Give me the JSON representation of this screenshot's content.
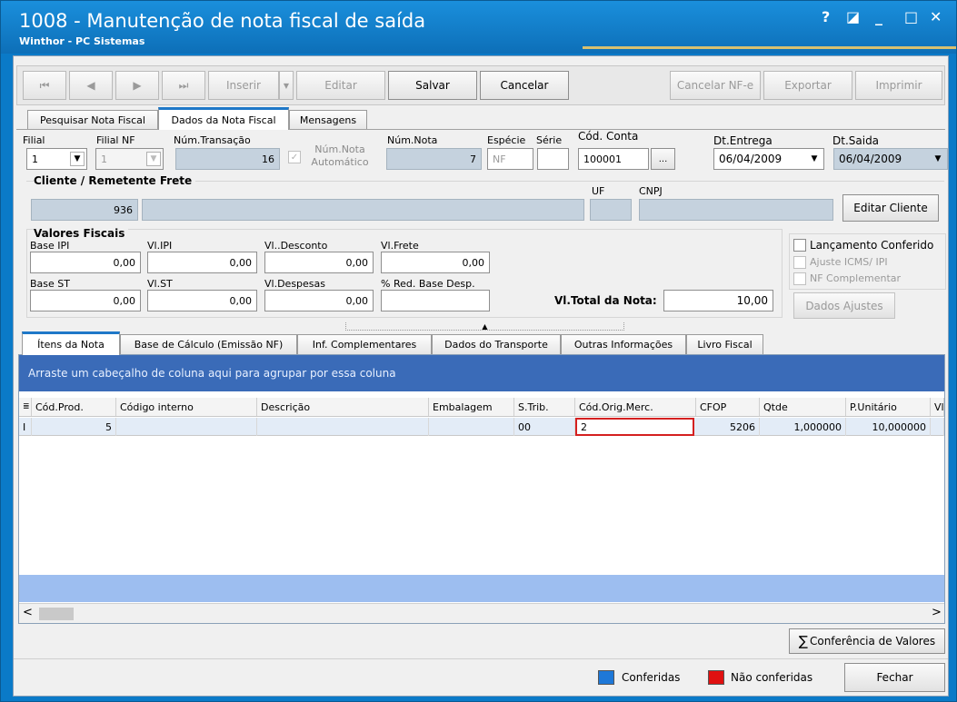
{
  "window": {
    "title": "1008 - Manutenção de nota fiscal de saída",
    "subtitle": "Winthor - PC Sistemas",
    "help": "?",
    "restore": "◪",
    "minimize": "_",
    "maximize": "□",
    "close": "✕"
  },
  "toolbar": {
    "first": "⏮",
    "prev": "◀",
    "next": "▶",
    "last": "⏭",
    "inserir": "Inserir",
    "inserir_arrow": "▼",
    "editar": "Editar",
    "salvar": "Salvar",
    "cancelar": "Cancelar",
    "cancelar_nfe": "Cancelar NF-e",
    "exportar": "Exportar",
    "imprimir": "Imprimir"
  },
  "tabs": [
    "Pesquisar Nota Fiscal",
    "Dados da Nota Fiscal",
    "Mensagens"
  ],
  "header": {
    "filial_label": "Filial",
    "filial_value": "1",
    "filial_nf_label": "Filial NF",
    "filial_nf_value": "1",
    "num_transacao_label": "Núm.Transação",
    "num_transacao_value": "16",
    "num_nota_auto_label": "Núm.Nota Automático",
    "num_nota_auto_check": "✓",
    "num_nota_label": "Núm.Nota",
    "num_nota_value": "7",
    "especie_label": "Espécie",
    "especie_value": "NF",
    "serie_label": "Série",
    "serie_value": "",
    "cod_conta_label": "Cód. Conta",
    "cod_conta_value": "100001",
    "cod_conta_btn": "...",
    "dt_entrega_label": "Dt.Entrega",
    "dt_entrega_value": "06/04/2009",
    "dt_saida_label": "Dt.Saida",
    "dt_saida_value": "06/04/2009",
    "dd_arrow": "▼"
  },
  "cliente": {
    "section_label": "Cliente / Remetente Frete",
    "codigo": "936",
    "nome": "",
    "uf_label": "UF",
    "uf_value": "",
    "cnpj_label": "CNPJ",
    "cnpj_value": "",
    "editar_btn": "Editar Cliente"
  },
  "fiscal": {
    "section_label": "Valores Fiscais",
    "base_ipi_label": "Base IPI",
    "base_ipi": "0,00",
    "vl_ipi_label": "Vl.IPI",
    "vl_ipi": "0,00",
    "vl_desconto_label": "Vl..Desconto",
    "vl_desconto": "0,00",
    "vl_frete_label": "Vl.Frete",
    "vl_frete": "0,00",
    "base_st_label": "Base ST",
    "base_st": "0,00",
    "vl_st_label": "Vl.ST",
    "vl_st": "0,00",
    "vl_despesas_label": "Vl.Despesas",
    "vl_despesas": "0,00",
    "red_base_label": "% Red. Base Desp.",
    "red_base": "",
    "vl_total_label": "Vl.Total da Nota:",
    "vl_total": "10,00"
  },
  "options": {
    "lancamento": "Lançamento Conferido",
    "ajuste": "Ajuste ICMS/ IPI",
    "nf_compl": "NF Complementar",
    "dados_ajustes": "Dados Ajustes"
  },
  "splitter": "▲",
  "subtabs": [
    "Ítens da Nota",
    "Base de Cálculo (Emissão NF)",
    "Inf. Complementares",
    "Dados do Transporte",
    "Outras Informações",
    "Livro Fiscal"
  ],
  "grid": {
    "group_hint": "Arraste um cabeçalho de coluna aqui para agrupar por essa coluna",
    "columns": [
      "Cód.Prod.",
      "Código interno",
      "Descrição",
      "Embalagem",
      "S.Trib.",
      "Cód.Orig.Merc.",
      "CFOP",
      "Qtde",
      "P.Unitário",
      "Vl.D"
    ],
    "row": {
      "indicator": "I",
      "cod_prod": "5",
      "codigo_interno": "",
      "descricao": "",
      "embalagem": "",
      "s_trib": "00",
      "cod_orig": "2",
      "cfop": "5206",
      "qtde": "1,000000",
      "p_unitario": "10,000000",
      "vl_d": ""
    },
    "scroll_left": "<",
    "scroll_right": ">"
  },
  "footer": {
    "conferencia_icon": "∑",
    "conferencia": "Conferência de Valores",
    "legend_conferidas": "Conferidas",
    "legend_nao": "Não conferidas",
    "fechar": "Fechar",
    "color_conferidas": "#1e78d8",
    "color_nao": "#e01010"
  }
}
